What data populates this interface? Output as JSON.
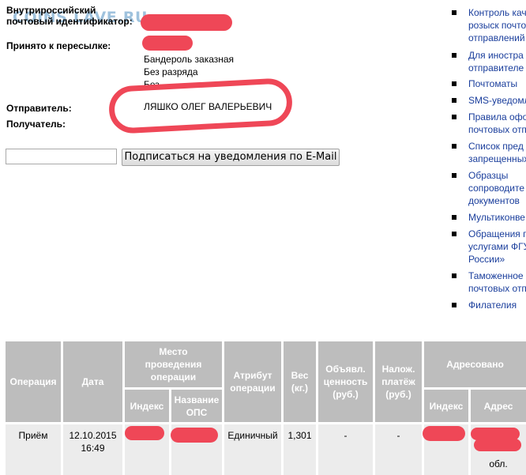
{
  "watermark": "COINS.LAVE.RU",
  "tracking": {
    "id_label": "Внутрироссийский почтовый идентификатор:",
    "accepted_label": "Принято к пересылке:",
    "details": [
      "Бандероль заказная",
      "Без разряда",
      "Без"
    ],
    "sender_label": "Отправитель:",
    "sender_name": "ЛЯШКО ОЛЕГ ВАЛЕРЬЕВИЧ",
    "recipient_label": "Получатель:"
  },
  "subscribe": {
    "email_value": "",
    "button_label": "Подписаться на уведомления по E-Mail"
  },
  "sidebar": {
    "items": [
      {
        "lines": [
          "Контроль кач",
          "розыск почтов",
          "отправлений"
        ]
      },
      {
        "lines": [
          "Для иностра",
          "отправителе"
        ]
      },
      {
        "lines": [
          "Почтоматы"
        ]
      },
      {
        "lines": [
          "SMS-уведомл"
        ]
      },
      {
        "lines": [
          "Правила офо",
          "почтовых отп"
        ]
      },
      {
        "lines": [
          "Список пред",
          "запрещенных"
        ]
      },
      {
        "lines": [
          "Образцы",
          "сопроводите",
          "документов"
        ]
      },
      {
        "lines": [
          "Мультиконве"
        ]
      },
      {
        "lines": [
          "Обращения п",
          "услугами ФГУ",
          "России»"
        ]
      },
      {
        "lines": [
          "Таможенное",
          "почтовых отп"
        ]
      },
      {
        "lines": [
          "Филателия"
        ]
      }
    ]
  },
  "history": {
    "headers": {
      "operation": "Операция",
      "date": "Дата",
      "place": "Место проведения операции",
      "index": "Индекс",
      "ops_name": "Название ОПС",
      "attribute": "Атрибут операции",
      "weight": "Вес (кг.)",
      "declared": "Объявл. ценность (руб.)",
      "cod": "Налож. платёж (руб.)",
      "addressed": "Адресовано",
      "addr_index": "Индекс",
      "address": "Адрес"
    },
    "rows": [
      {
        "operation": "Приём",
        "date": "12.10.2015",
        "time": "16:49",
        "attribute": "Единичный",
        "weight": "1,301",
        "declared": "-",
        "cod": "-",
        "address_tail": "обл."
      }
    ]
  },
  "colors": {
    "redaction": "#ef4757",
    "link": "#1a3e9c",
    "table_header": "#bdbdbd",
    "table_row": "#ececec"
  }
}
